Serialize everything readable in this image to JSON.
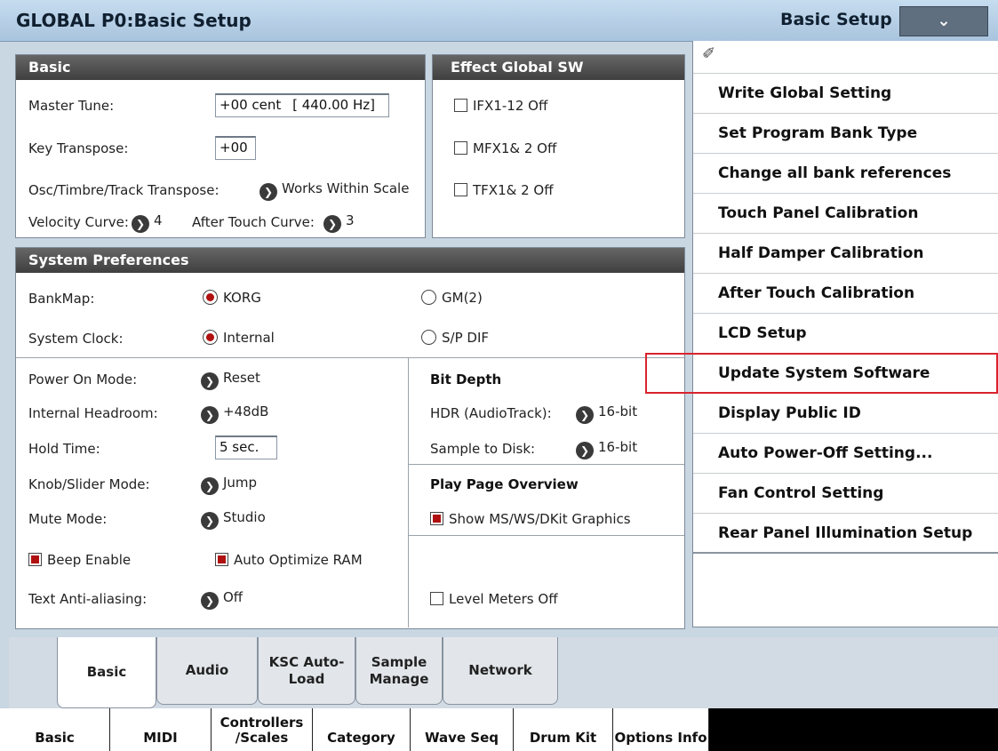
{
  "header": {
    "title": "GLOBAL P0:Basic Setup",
    "page_menu_label": "Basic Setup",
    "dropdown_glyph": "⌄"
  },
  "basic": {
    "heading": "Basic",
    "master_tune_label": "Master Tune:",
    "master_tune_value": "+00 cent",
    "master_tune_hz": "[ 440.00 Hz]",
    "key_transpose_label": "Key Transpose:",
    "key_transpose_value": "+00",
    "osc_label": "Osc/Timbre/Track Transpose:",
    "osc_value": "Works Within Scale",
    "velocity_label": "Velocity Curve:",
    "velocity_value": "4",
    "aftertouch_label": "After Touch Curve:",
    "aftertouch_value": "3"
  },
  "effect_sw": {
    "heading": "Effect Global SW",
    "ifx": "IFX1-12 Off",
    "mfx": "MFX1& 2 Off",
    "tfx": "TFX1& 2 Off"
  },
  "prefs": {
    "heading": "System Preferences",
    "bankmap_label": "BankMap:",
    "bankmap_opt1": "KORG",
    "bankmap_opt2": "GM(2)",
    "clock_label": "System Clock:",
    "clock_opt1": "Internal",
    "clock_opt2": "S/P DIF",
    "power_label": "Power On Mode:",
    "power_value": "Reset",
    "headroom_label": "Internal Headroom:",
    "headroom_value": "+48dB",
    "hold_label": "Hold Time:",
    "hold_value": "5 sec.",
    "knob_label": "Knob/Slider Mode:",
    "knob_value": "Jump",
    "mute_label": "Mute Mode:",
    "mute_value": "Studio",
    "beep": "Beep Enable",
    "auto_opt": "Auto Optimize RAM",
    "aa_label": "Text Anti-aliasing:",
    "aa_value": "Off",
    "bit_depth_head": "Bit Depth",
    "hdr_label": "HDR (AudioTrack):",
    "hdr_value": "16-bit",
    "s2d_label": "Sample to Disk:",
    "s2d_value": "16-bit",
    "ppo_head": "Play Page Overview",
    "show_ms": "Show MS/WS/DKit Graphics",
    "level_meters": "Level Meters Off"
  },
  "menu": {
    "pin_glyph": "✐",
    "items": [
      "Write Global Setting",
      "Set Program Bank Type",
      "Change all bank references",
      "Touch Panel Calibration",
      "Half Damper Calibration",
      "After Touch Calibration",
      "LCD Setup",
      "Update System Software",
      "Display Public ID",
      "Auto Power-Off Setting...",
      "Fan Control Setting",
      "Rear Panel Illumination Setup"
    ]
  },
  "tabs": [
    "Basic",
    "Audio",
    "KSC Auto-Load",
    "Sample Manage",
    "Network"
  ],
  "bottom_tabs": [
    "Basic",
    "MIDI",
    "Controllers /Scales",
    "Category",
    "Wave Seq",
    "Drum Kit",
    "Options Info"
  ],
  "chevron_glyph": "❯"
}
